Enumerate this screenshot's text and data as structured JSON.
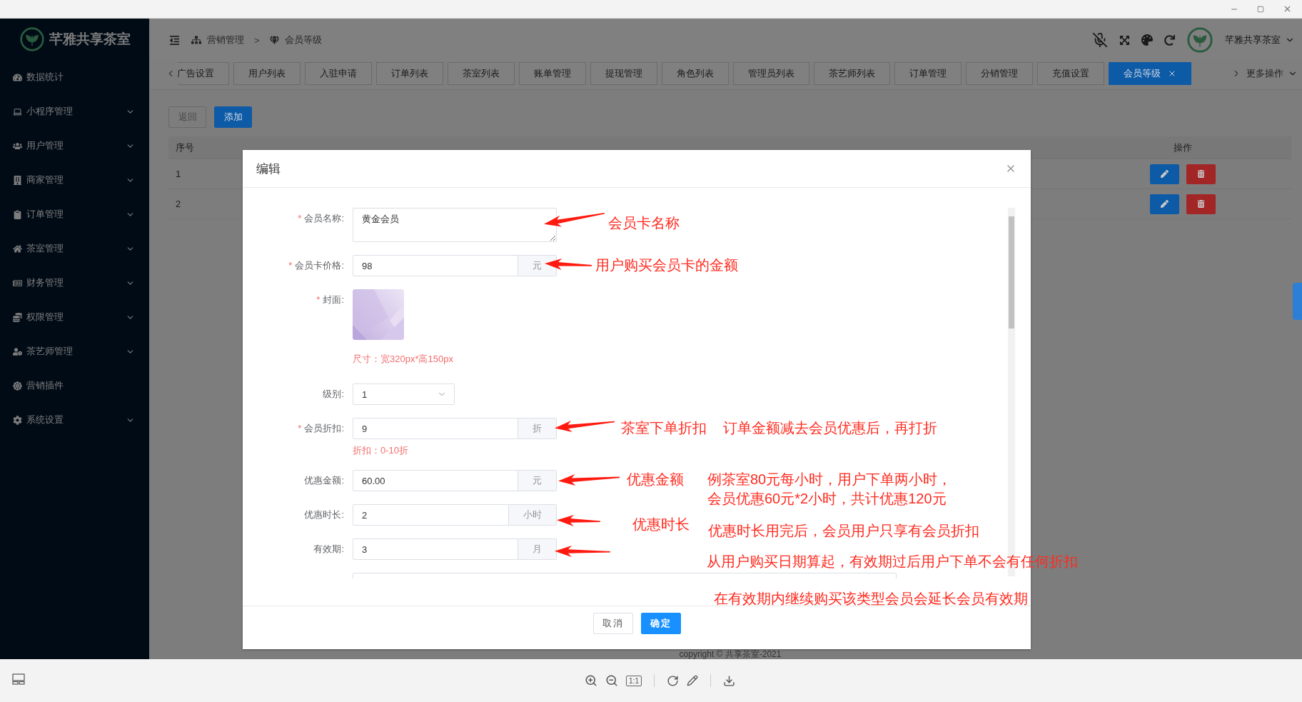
{
  "brand": "芊雅共享茶室",
  "sidebar": {
    "items": [
      {
        "label": "数据统计",
        "kind": "link"
      },
      {
        "label": "小程序管理",
        "kind": "group"
      },
      {
        "label": "用户管理",
        "kind": "group"
      },
      {
        "label": "商家管理",
        "kind": "group"
      },
      {
        "label": "订单管理",
        "kind": "group"
      },
      {
        "label": "茶室管理",
        "kind": "group"
      },
      {
        "label": "财务管理",
        "kind": "group"
      },
      {
        "label": "权限管理",
        "kind": "group"
      },
      {
        "label": "茶艺师管理",
        "kind": "group"
      },
      {
        "label": "营销插件",
        "kind": "link"
      },
      {
        "label": "系统设置",
        "kind": "group"
      }
    ]
  },
  "breadcrumb": {
    "items": [
      "营销管理",
      "会员等级"
    ],
    "separator": ">"
  },
  "user": {
    "name": "芊雅共享茶室"
  },
  "tabs": [
    {
      "label": "广告设置",
      "selected": false
    },
    {
      "label": "用户列表",
      "selected": false
    },
    {
      "label": "入驻申请",
      "selected": false
    },
    {
      "label": "订单列表",
      "selected": false
    },
    {
      "label": "茶室列表",
      "selected": false
    },
    {
      "label": "账单管理",
      "selected": false
    },
    {
      "label": "提现管理",
      "selected": false
    },
    {
      "label": "角色列表",
      "selected": false
    },
    {
      "label": "管理员列表",
      "selected": false
    },
    {
      "label": "茶艺师列表",
      "selected": false
    },
    {
      "label": "订单管理",
      "selected": false
    },
    {
      "label": "分销管理",
      "selected": false
    },
    {
      "label": "充值设置",
      "selected": false
    },
    {
      "label": "会员等级",
      "selected": true
    }
  ],
  "tabs_more": "更多操作",
  "actions": [
    {
      "label": "返回",
      "kind": "default"
    },
    {
      "label": "添加",
      "kind": "primary"
    }
  ],
  "table": {
    "columns": [
      "序号",
      "操作"
    ],
    "rows": [
      {
        "index": "1"
      },
      {
        "index": "2"
      }
    ]
  },
  "footer": "copyright © 共享茶室-2021",
  "modal": {
    "title": "编辑",
    "required_mark": "*",
    "fields": [
      {
        "kind": "textarea",
        "label": "会员名称:",
        "required": true,
        "value": "黄金会员"
      },
      {
        "kind": "addon",
        "label": "会员卡价格:",
        "required": true,
        "value": "98",
        "addon": "元"
      },
      {
        "label": "封面:",
        "required": true,
        "hint": "尺寸：宽320px*高150px"
      },
      {
        "kind": "select",
        "label": "级别:",
        "required": false,
        "value": "1"
      },
      {
        "kind": "addon",
        "label": "会员折扣:",
        "required": true,
        "value": "9",
        "addon": "折",
        "hint": "折扣：0-10折"
      },
      {
        "kind": "addon",
        "label": "优惠金额:",
        "required": false,
        "value": "60.00",
        "addon": "元"
      },
      {
        "kind": "addon",
        "label": "优惠时长:",
        "required": false,
        "value": "2",
        "addon": "小时"
      },
      {
        "kind": "addon",
        "label": "有效期:",
        "required": false,
        "value": "3",
        "addon": "月"
      }
    ],
    "buttons": [
      {
        "label": "取消",
        "kind": "default"
      },
      {
        "label": "确定",
        "kind": "primary"
      }
    ]
  },
  "annotations": [
    {
      "text": "会员卡名称",
      "arrow": true
    },
    {
      "text": "用户购买会员卡的金额",
      "arrow": true
    },
    {
      "text": "茶室下单折扣",
      "arrow": true
    },
    {
      "text": "订单金额减去会员优惠后，再打折",
      "arrow": false
    },
    {
      "text": "优惠金额",
      "arrow": true
    },
    {
      "text": "例茶室80元每小时，用户下单两小时，",
      "arrow": false
    },
    {
      "text": "会员优惠60元*2小时，共计优惠120元",
      "arrow": false
    },
    {
      "text": "优惠时长",
      "arrow": true
    },
    {
      "text": "优惠时长用完后，会员用户只享有会员折扣",
      "arrow": false
    },
    {
      "text": "从用户购买日期算起，有效期过后用户下单不会有任何折扣",
      "arrow": true
    },
    {
      "text": "在有效期内继续购买该类型会员会延长会员有效期",
      "arrow": false
    }
  ],
  "viewer": {
    "actual_size": "1:1"
  }
}
